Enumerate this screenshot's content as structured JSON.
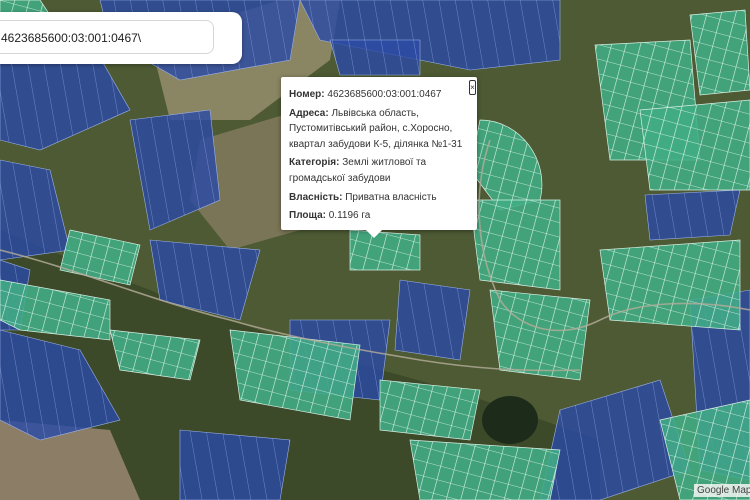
{
  "search": {
    "value": "4623685600:03:001:0467\\"
  },
  "popup": {
    "rows": [
      {
        "label": "Номер:",
        "value": "4623685600:03:001:0467"
      },
      {
        "label": "Адреса:",
        "value": "Львівська область, Пустомитівський район, с.Хоросно, квартал забудови К-5, ділянка №1-31"
      },
      {
        "label": "Категорія:",
        "value": "Землі житлової та громадської забудови"
      },
      {
        "label": "Власність:",
        "value": "Приватна власність"
      },
      {
        "label": "Площа:",
        "value": "0.1196 га"
      }
    ],
    "close_label": "×"
  },
  "attribution": "Google Map",
  "colors": {
    "parcel_private": "#3fae83",
    "parcel_other": "#2d4fa8",
    "imagery_fields": "#5a6a3a",
    "imagery_village": "#4c4a3a",
    "road": "#b5ad9a"
  }
}
